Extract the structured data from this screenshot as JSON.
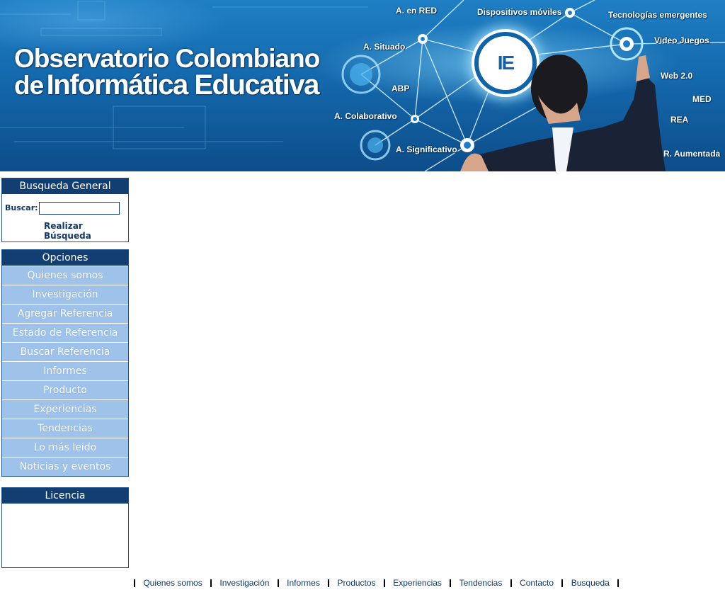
{
  "banner": {
    "title_line1": "Observatorio Colombiano",
    "title_line2_prefix": "de",
    "title_line2_main": "Informática Educativa",
    "logo_text": "IE",
    "tags": {
      "a_en_red": "A. en RED",
      "dispositivos": "Dispositivos móviles",
      "tecnologias": "Tecnologías emergentes",
      "situado": "A. Situado",
      "video_juegos": "Video Juegos",
      "abp": "ABP",
      "web20": "Web 2.0",
      "med": "MED",
      "colaborativo": "A. Colaborativo",
      "rea": "REA",
      "significativo": "A. Significativo",
      "aumentada": "R. Aumentada"
    }
  },
  "search": {
    "title": "Busqueda General",
    "label": "Buscar:",
    "value": "",
    "button": "Realizar Búsqueda"
  },
  "menu": {
    "title": "Opciones",
    "items": [
      "Quienes somos",
      "Investigación",
      "Agregar Referencia",
      "Estado de Referencia",
      "Buscar Referencia",
      "Informes",
      "Producto",
      "Experiencias",
      "Tendencias",
      "Lo más leido",
      "Noticias y eventos"
    ]
  },
  "license": {
    "title": "Licencia"
  },
  "footer": {
    "links": [
      "Quienes somos",
      "Investigación",
      "Informes",
      "Productos",
      "Experiencias",
      "Tendencias",
      "Contacto",
      "Busqueda"
    ]
  }
}
